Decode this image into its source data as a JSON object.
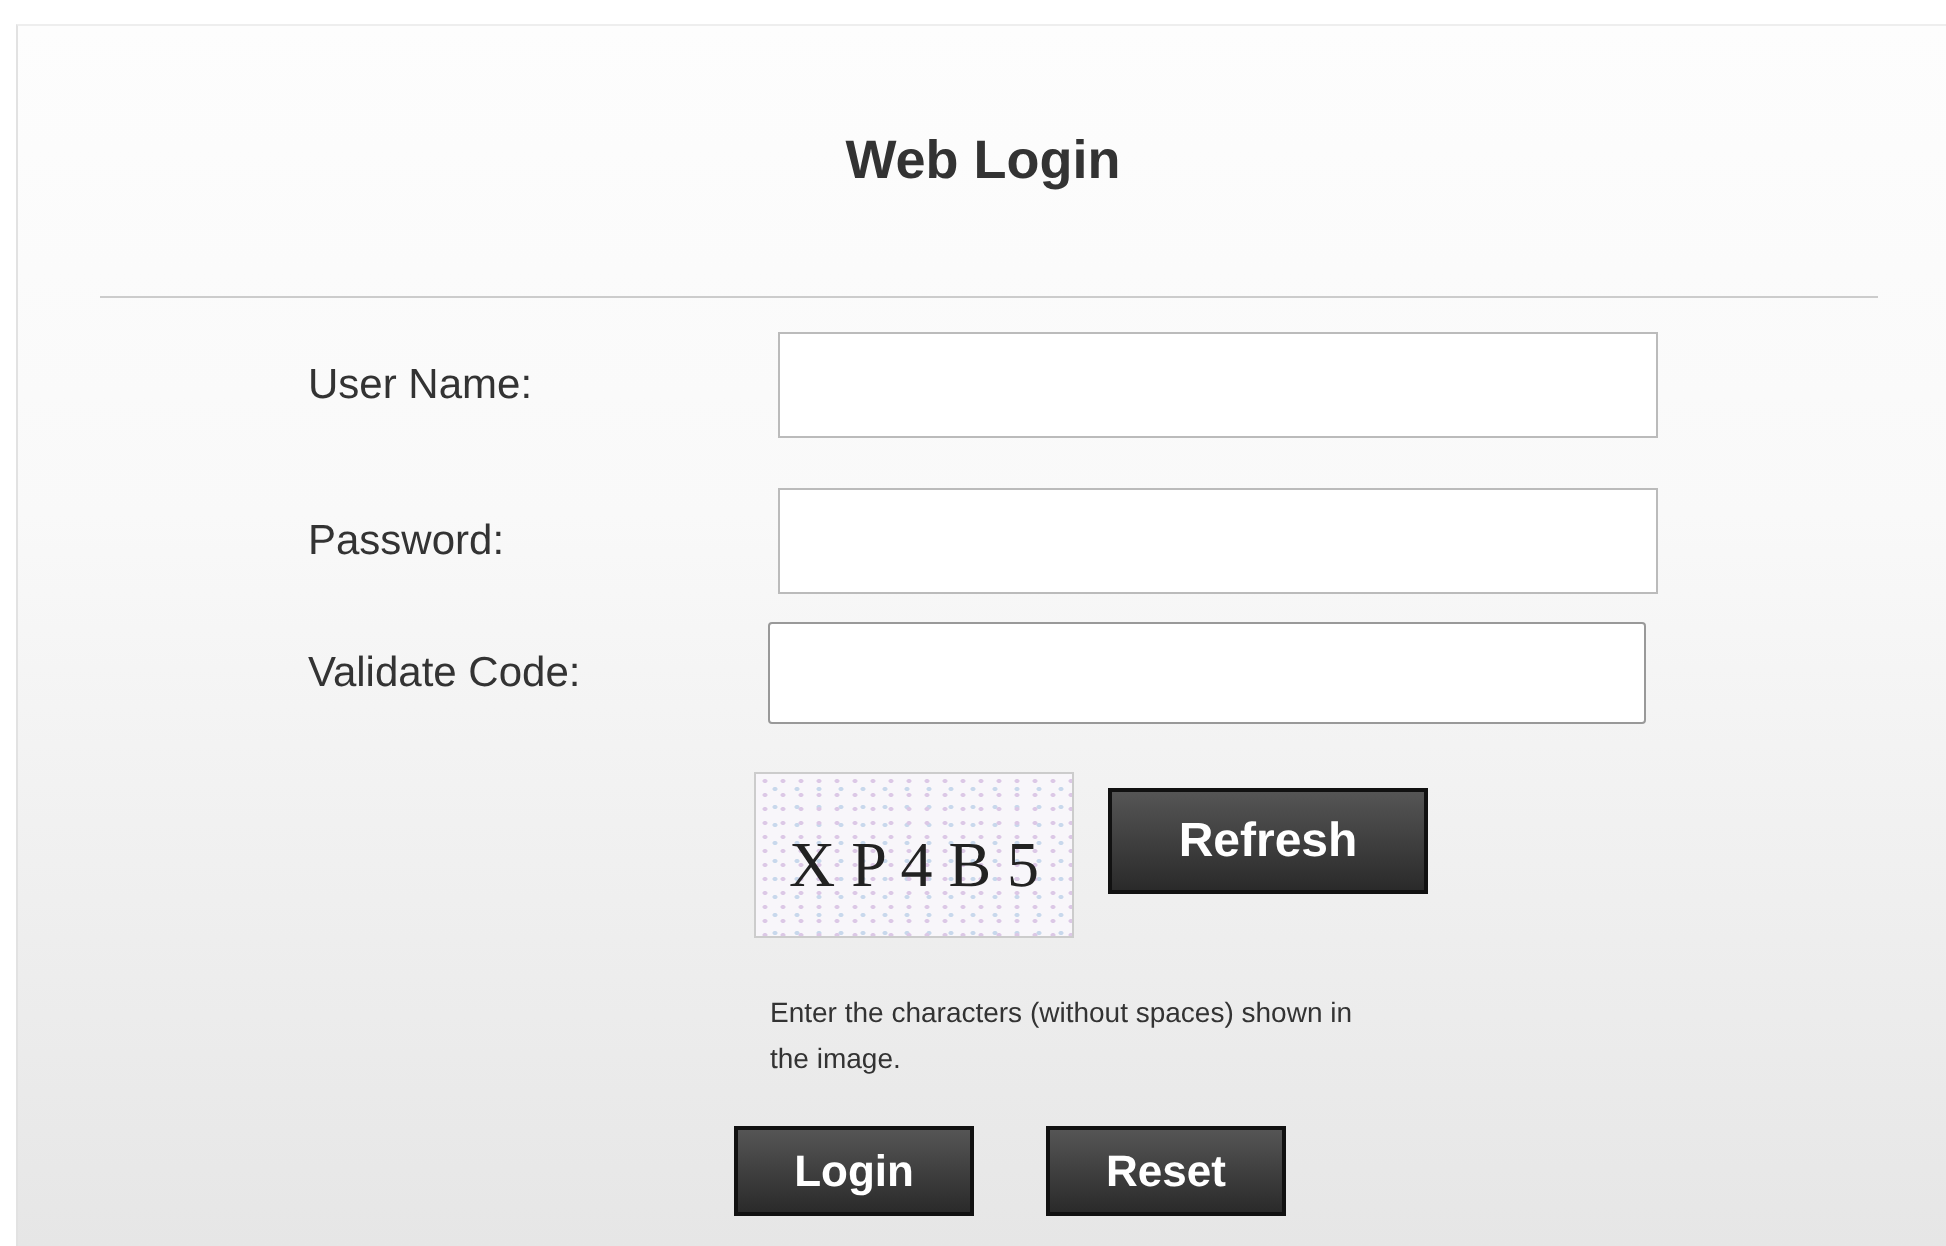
{
  "title": "Web Login",
  "fields": [
    {
      "label": "User Name:"
    },
    {
      "label": "Password:"
    },
    {
      "label": "Validate Code:"
    }
  ],
  "captcha": {
    "code": "X P 4 B 5",
    "button": "Refresh",
    "hint": "Enter the characters (without spaces) shown in the image."
  },
  "buttons": [
    "Login",
    "Reset"
  ]
}
